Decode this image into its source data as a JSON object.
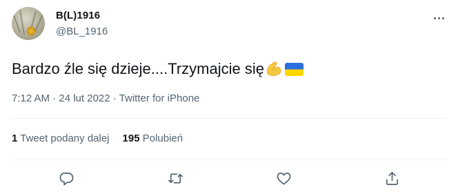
{
  "author": {
    "name": "B(L)1916",
    "handle": "@BL_1916"
  },
  "tweet": {
    "text": "Bardzo źle się dzieje....Trzymajcie się",
    "emoji": [
      "flexed-biceps",
      "ukraine-flag"
    ],
    "meta": "7:12 AM · 24 lut 2022 · Twitter for iPhone"
  },
  "stats": {
    "retweets_count": "1",
    "retweets_label": "Tweet podany dalej",
    "likes_count": "195",
    "likes_label": "Polubień"
  },
  "colors": {
    "text": "#0f1419",
    "secondary": "#536471",
    "divider": "#eff3f4",
    "flag_blue": "#2a6ee0",
    "flag_yellow": "#ffd700"
  },
  "icons": [
    "more-icon",
    "reply-icon",
    "retweet-icon",
    "like-icon",
    "share-icon"
  ]
}
